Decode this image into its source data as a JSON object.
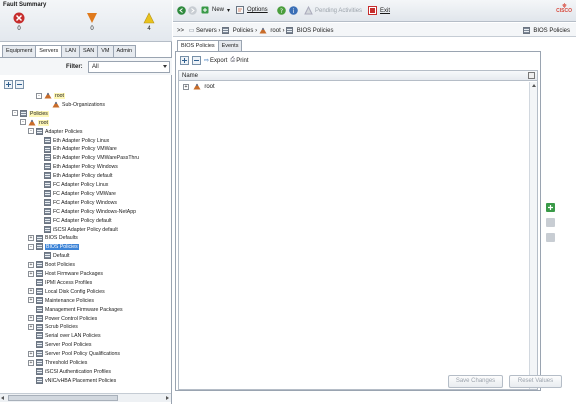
{
  "fault_summary": {
    "title": "Fault Summary",
    "items": [
      {
        "icon": "critical-icon",
        "count": "0",
        "color": "#c62d2d"
      },
      {
        "icon": "major-icon",
        "count": "0",
        "color": "#e07a1c"
      },
      {
        "icon": "minor-icon",
        "count": "4",
        "color": "#e8c21d"
      }
    ]
  },
  "nav_tabs": [
    "Equipment",
    "Servers",
    "LAN",
    "SAN",
    "VM",
    "Admin"
  ],
  "nav_active_tab": "Servers",
  "filter": {
    "label": "Filter:",
    "value": "All"
  },
  "tree": [
    {
      "label": "root",
      "indent": 4,
      "exp": "-",
      "icon": "org",
      "hl": true
    },
    {
      "label": "Sub-Organizations",
      "indent": 5,
      "exp": "",
      "icon": "org"
    },
    {
      "label": "Policies",
      "indent": 1,
      "exp": "-",
      "icon": "folder",
      "hl": true
    },
    {
      "label": "root",
      "indent": 2,
      "exp": "-",
      "icon": "org",
      "hl": true
    },
    {
      "label": "Adapter Policies",
      "indent": 3,
      "exp": "-",
      "icon": "folder"
    },
    {
      "label": "Eth Adapter Policy Linux",
      "indent": 4,
      "exp": "",
      "icon": "folder"
    },
    {
      "label": "Eth Adapter Policy VMWare",
      "indent": 4,
      "exp": "",
      "icon": "folder"
    },
    {
      "label": "Eth Adapter Policy VMWarePassThru",
      "indent": 4,
      "exp": "",
      "icon": "folder"
    },
    {
      "label": "Eth Adapter Policy Windows",
      "indent": 4,
      "exp": "",
      "icon": "folder"
    },
    {
      "label": "Eth Adapter Policy default",
      "indent": 4,
      "exp": "",
      "icon": "folder"
    },
    {
      "label": "FC Adapter Policy Linux",
      "indent": 4,
      "exp": "",
      "icon": "folder"
    },
    {
      "label": "FC Adapter Policy VMWare",
      "indent": 4,
      "exp": "",
      "icon": "folder"
    },
    {
      "label": "FC Adapter Policy Windows",
      "indent": 4,
      "exp": "",
      "icon": "folder"
    },
    {
      "label": "FC Adapter Policy Windows-NetApp",
      "indent": 4,
      "exp": "",
      "icon": "folder"
    },
    {
      "label": "FC Adapter Policy default",
      "indent": 4,
      "exp": "",
      "icon": "folder"
    },
    {
      "label": "iSCSI Adapter Policy default",
      "indent": 4,
      "exp": "",
      "icon": "folder"
    },
    {
      "label": "BIOS Defaults",
      "indent": 3,
      "exp": "+",
      "icon": "folder"
    },
    {
      "label": "BIOS Policies",
      "indent": 3,
      "exp": "-",
      "icon": "folder",
      "sel": true
    },
    {
      "label": "Default",
      "indent": 4,
      "exp": "",
      "icon": "folder"
    },
    {
      "label": "Boot Policies",
      "indent": 3,
      "exp": "+",
      "icon": "folder"
    },
    {
      "label": "Host Firmware Packages",
      "indent": 3,
      "exp": "+",
      "icon": "folder"
    },
    {
      "label": "IPMI Access Profiles",
      "indent": 3,
      "exp": "",
      "icon": "folder"
    },
    {
      "label": "Local Disk Config Policies",
      "indent": 3,
      "exp": "+",
      "icon": "folder"
    },
    {
      "label": "Maintenance Policies",
      "indent": 3,
      "exp": "+",
      "icon": "folder"
    },
    {
      "label": "Management Firmware Packages",
      "indent": 3,
      "exp": "",
      "icon": "folder"
    },
    {
      "label": "Power Control Policies",
      "indent": 3,
      "exp": "+",
      "icon": "folder"
    },
    {
      "label": "Scrub Policies",
      "indent": 3,
      "exp": "+",
      "icon": "folder"
    },
    {
      "label": "Serial over LAN Policies",
      "indent": 3,
      "exp": "",
      "icon": "folder"
    },
    {
      "label": "Server Pool Policies",
      "indent": 3,
      "exp": "",
      "icon": "folder"
    },
    {
      "label": "Server Pool Policy Qualifications",
      "indent": 3,
      "exp": "+",
      "icon": "folder"
    },
    {
      "label": "Threshold Policies",
      "indent": 3,
      "exp": "+",
      "icon": "folder"
    },
    {
      "label": "iSCSI Authentication Profiles",
      "indent": 3,
      "exp": "",
      "icon": "folder"
    },
    {
      "label": "vNIC/vHBA Placement Policies",
      "indent": 3,
      "exp": "",
      "icon": "folder"
    }
  ],
  "toolbar": {
    "new_label": "New",
    "options_label": "Options",
    "pending_label": "Pending Activities",
    "exit_label": "Exit",
    "logo_text": "CISCO"
  },
  "breadcrumb": {
    "prefix": ">>",
    "items": [
      "Servers",
      "Policies",
      "root",
      "BIOS Policies"
    ],
    "right_label": "BIOS Policies"
  },
  "content_tabs": [
    "BIOS Policies",
    "Events"
  ],
  "content_active_tab": "BIOS Policies",
  "content_tools": {
    "export_label": "Export",
    "print_label": "Print"
  },
  "grid": {
    "column": "Name",
    "rows": [
      "root"
    ]
  },
  "buttons": {
    "save_label": "Save Changes",
    "reset_label": "Reset Values"
  }
}
